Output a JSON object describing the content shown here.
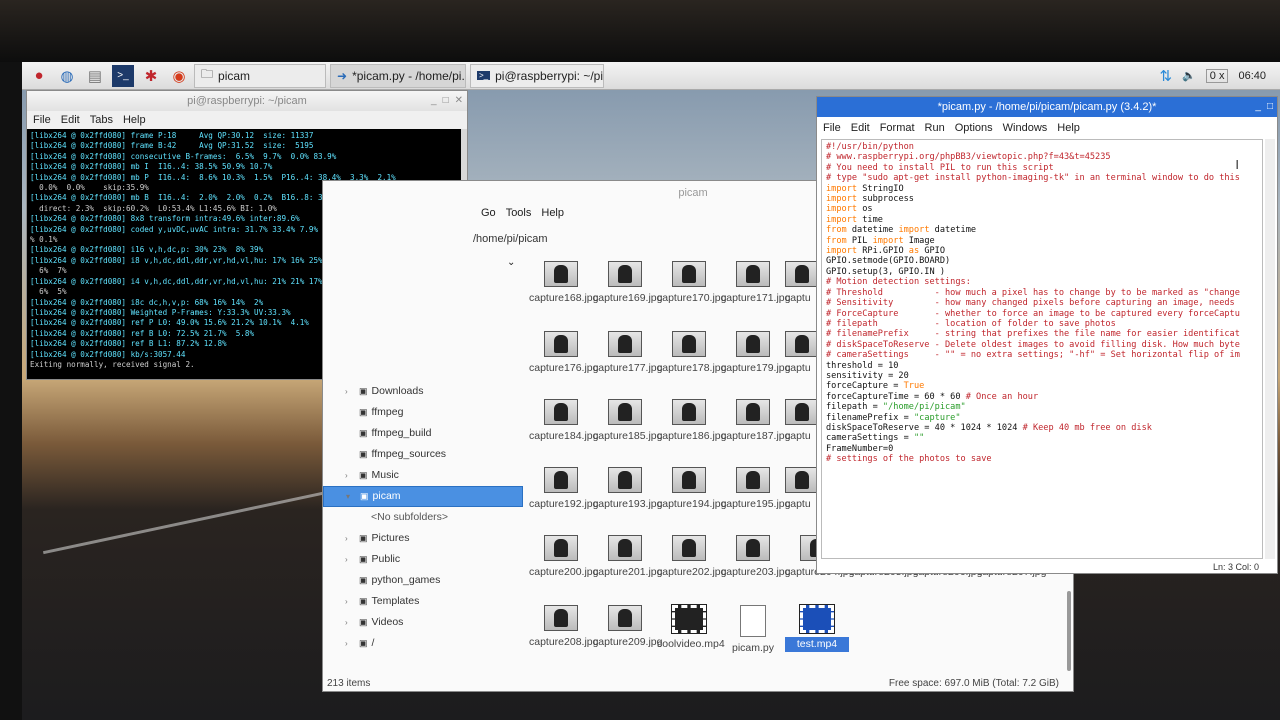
{
  "taskbar": {
    "buttons": [
      {
        "label": "picam",
        "icon": "folder-icon"
      },
      {
        "label": "*picam.py - /home/pi...",
        "icon": "python-icon"
      },
      {
        "label": "pi@raspberrypi: ~/pi...",
        "icon": "terminal-icon"
      }
    ],
    "tray_num": "0",
    "tray_x": "x",
    "clock": "06:40"
  },
  "terminal": {
    "title": "pi@raspberrypi: ~/picam",
    "menu": [
      "File",
      "Edit",
      "Tabs",
      "Help"
    ],
    "lines": [
      "[libx264 @ 0x2ffd080] frame P:18     Avg QP:30.12  size: 11337",
      "[libx264 @ 0x2ffd080] frame B:42     Avg QP:31.52  size:  5195",
      "[libx264 @ 0x2ffd080] consecutive B-frames:  6.5%  9.7%  0.0% 83.9%",
      "[libx264 @ 0x2ffd080] mb I  I16..4: 38.5% 50.9% 10.7%",
      "[libx264 @ 0x2ffd080] mb P  I16..4:  8.6% 10.3%  1.5%  P16..4: 38.4%  3.3%  2.1%",
      "  0.0%  0.0%    skip:35.9%",
      "[libx264 @ 0x2ffd080] mb B  I16..4:  2.0%  2.0%  0.2%  B16..8: 30.9%  2.1%  0.3%",
      "  direct: 2.3%  skip:60.2%  L0:53.4% L1:45.6% BI: 1.0%",
      "[libx264 @ 0x2ffd080] 8x8 transform intra:49.6% inter:89.6%",
      "[libx264 @ 0x2ffd080] coded y,uvDC,uvAC intra: 31.7% 33.4% 7.9% inter: 8.4% 15.7%",
      "% 0.1%",
      "[libx264 @ 0x2ffd080] i16 v,h,dc,p: 30% 23%  8% 39%",
      "[libx264 @ 0x2ffd080] i8 v,h,dc,ddl,ddr,vr,hd,vl,hu: 17% 16% 25%  6%  8%  8%  8%",
      "  6%  7%",
      "[libx264 @ 0x2ffd080] i4 v,h,dc,ddl,ddr,vr,hd,vl,hu: 21% 21% 17%  6%  8%  8%  8%",
      "  6%  5%",
      "[libx264 @ 0x2ffd080] i8c dc,h,v,p: 68% 16% 14%  2%",
      "[libx264 @ 0x2ffd080] Weighted P-Frames: Y:33.3% UV:33.3%",
      "[libx264 @ 0x2ffd080] ref P L0: 49.0% 15.6% 21.2% 10.1%  4.1%",
      "[libx264 @ 0x2ffd080] ref B L0: 72.5% 21.7%  5.8%",
      "[libx264 @ 0x2ffd080] ref B L1: 87.2% 12.8%",
      "[libx264 @ 0x2ffd080] kb/s:3057.44",
      "Exiting normally, received signal 2."
    ]
  },
  "file_manager": {
    "title": "picam",
    "menu": [
      "Go",
      "Tools",
      "Help"
    ],
    "path": "/home/pi/picam",
    "sidebar": [
      {
        "label": "Downloads",
        "expander": "›",
        "selected": false,
        "sub": false
      },
      {
        "label": "ffmpeg",
        "expander": "",
        "selected": false,
        "sub": false
      },
      {
        "label": "ffmpeg_build",
        "expander": "",
        "selected": false,
        "sub": false
      },
      {
        "label": "ffmpeg_sources",
        "expander": "",
        "selected": false,
        "sub": false
      },
      {
        "label": "Music",
        "expander": "›",
        "selected": false,
        "sub": false
      },
      {
        "label": "picam",
        "expander": "▾",
        "selected": true,
        "sub": false
      },
      {
        "label": "<No subfolders>",
        "expander": "",
        "selected": false,
        "sub": true
      },
      {
        "label": "Pictures",
        "expander": "›",
        "selected": false,
        "sub": false
      },
      {
        "label": "Public",
        "expander": "›",
        "selected": false,
        "sub": false
      },
      {
        "label": "python_games",
        "expander": "",
        "selected": false,
        "sub": false
      },
      {
        "label": "Templates",
        "expander": "›",
        "selected": false,
        "sub": false
      },
      {
        "label": "Videos",
        "expander": "›",
        "selected": false,
        "sub": false
      },
      {
        "label": "/",
        "expander": "›",
        "selected": false,
        "sub": false
      }
    ],
    "files": [
      [
        "capture168.jpg",
        "capture169.jpg",
        "capture170.jpg",
        "capture171.jpg",
        "captu"
      ],
      [
        "capture176.jpg",
        "capture177.jpg",
        "capture178.jpg",
        "capture179.jpg",
        "captu"
      ],
      [
        "capture184.jpg",
        "capture185.jpg",
        "capture186.jpg",
        "capture187.jpg",
        "captu"
      ],
      [
        "capture192.jpg",
        "capture193.jpg",
        "capture194.jpg",
        "capture195.jpg",
        "captu"
      ],
      [
        "capture200.jpg",
        "capture201.jpg",
        "capture202.jpg",
        "capture203.jpg",
        "capture204.jpg",
        "capture205.jpg",
        "capture206.jpg",
        "capture207.jpg"
      ],
      [
        "capture208.jpg",
        "capture209.jpg",
        "coolvideo.mp4",
        "picam.py",
        "test.mp4"
      ]
    ],
    "status_items": "213 items",
    "status_free": "Free space: 697.0 MiB (Total: 7.2 GiB)"
  },
  "idle": {
    "title": "*picam.py - /home/pi/picam/picam.py (3.4.2)*",
    "menu": [
      "File",
      "Edit",
      "Format",
      "Run",
      "Options",
      "Windows",
      "Help"
    ],
    "status": "Ln: 3 Col: 0",
    "code": [
      {
        "t": "c",
        "s": "#!/usr/bin/python"
      },
      {
        "t": "n",
        "s": ""
      },
      {
        "t": "c",
        "s": "# www.raspberrypi.org/phpBB3/viewtopic.php?f=43&t=45235"
      },
      {
        "t": "n",
        "s": ""
      },
      {
        "t": "c",
        "s": "# You need to install PIL to run this script"
      },
      {
        "t": "c",
        "s": "# type \"sudo apt-get install python-imaging-tk\" in an terminal window to do this"
      },
      {
        "t": "n",
        "s": ""
      },
      {
        "t": "i",
        "s": "import StringIO"
      },
      {
        "t": "i",
        "s": "import subprocess"
      },
      {
        "t": "i",
        "s": "import os"
      },
      {
        "t": "i",
        "s": "import time"
      },
      {
        "t": "f",
        "s": "from datetime import datetime"
      },
      {
        "t": "f",
        "s": "from PIL import Image"
      },
      {
        "t": "n",
        "s": ""
      },
      {
        "t": "i",
        "s": "import RPi.GPIO as GPIO"
      },
      {
        "t": "n",
        "s": "GPIO.setmode(GPIO.BOARD)"
      },
      {
        "t": "n",
        "s": "GPIO.setup(3, GPIO.IN )"
      },
      {
        "t": "n",
        "s": ""
      },
      {
        "t": "c",
        "s": "# Motion detection settings:"
      },
      {
        "t": "c",
        "s": "# Threshold          - how much a pixel has to change by to be marked as \"change"
      },
      {
        "t": "c",
        "s": "# Sensitivity        - how many changed pixels before capturing an image, needs"
      },
      {
        "t": "c",
        "s": "# ForceCapture       - whether to force an image to be captured every forceCaptu"
      },
      {
        "t": "c",
        "s": "# filepath           - location of folder to save photos"
      },
      {
        "t": "c",
        "s": "# filenamePrefix     - string that prefixes the file name for easier identificat"
      },
      {
        "t": "c",
        "s": "# diskSpaceToReserve - Delete oldest images to avoid filling disk. How much byte"
      },
      {
        "t": "c",
        "s": "# cameraSettings     - \"\" = no extra settings; \"-hf\" = Set horizontal flip of im"
      },
      {
        "t": "n",
        "s": "threshold = 10"
      },
      {
        "t": "n",
        "s": "sensitivity = 20"
      },
      {
        "t": "v",
        "s": "forceCapture = True"
      },
      {
        "t": "x",
        "s": "forceCaptureTime = 60 * 60 # Once an hour"
      },
      {
        "t": "q",
        "s": "filepath = \"/home/pi/picam\""
      },
      {
        "t": "q",
        "s": "filenamePrefix = \"capture\""
      },
      {
        "t": "x",
        "s": "diskSpaceToReserve = 40 * 1024 * 1024 # Keep 40 mb free on disk"
      },
      {
        "t": "q",
        "s": "cameraSettings = \"\""
      },
      {
        "t": "n",
        "s": ""
      },
      {
        "t": "n",
        "s": "FrameNumber=0"
      },
      {
        "t": "n",
        "s": ""
      },
      {
        "t": "c",
        "s": "# settings of the photos to save"
      }
    ]
  }
}
